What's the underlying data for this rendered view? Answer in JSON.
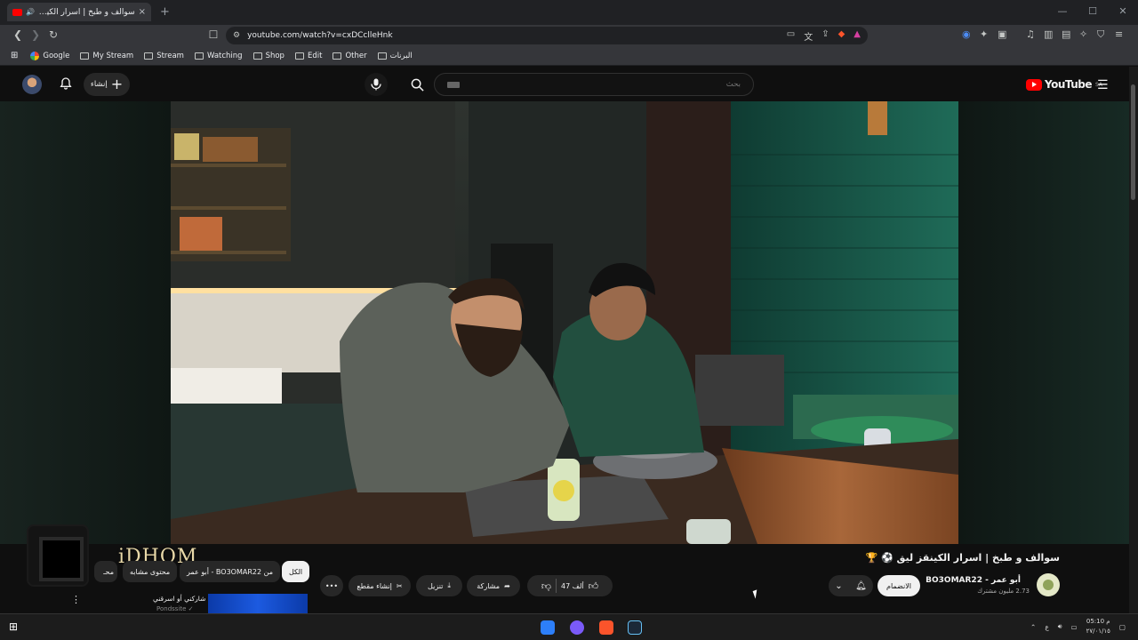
{
  "browser": {
    "tab_title": "سوالف و طبخ | اسرار الكينقز لي...",
    "tab_close": "×",
    "new_tab": "+",
    "url": "youtube.com/watch?v=cxDCclleHnk",
    "window_controls": [
      "—",
      "☐",
      "✕"
    ],
    "bookmarks": [
      {
        "label": "Google",
        "icon": "google-icon"
      },
      {
        "label": "My Stream",
        "icon": "folder-icon"
      },
      {
        "label": "Stream",
        "icon": "folder-icon"
      },
      {
        "label": "Watching",
        "icon": "folder-icon"
      },
      {
        "label": "Shop",
        "icon": "folder-icon"
      },
      {
        "label": "Edit",
        "icon": "folder-icon"
      },
      {
        "label": "Other",
        "icon": "folder-icon"
      },
      {
        "label": "البرنات",
        "icon": "folder-icon"
      }
    ]
  },
  "youtube": {
    "create_label": "إنشاء",
    "search_placeholder": "بحث",
    "logo_text": "YouTube",
    "logo_region": "SA"
  },
  "video": {
    "title": "سوالف و طبخ | اسرار الكينقز ليق ⚽ 🏆",
    "channel_name": "أبو عمر - BO3OMAR22",
    "subscribers": "2.73 مليون مشترك",
    "join_label": "الانضمام",
    "likes": "47 ألف",
    "share_label": "مشاركة",
    "download_label": "تنزيل",
    "clip_label": "إنشاء مقطع",
    "more_label": "•••"
  },
  "chips": {
    "all": "الكل",
    "from_channel": "من BO3OMAR22 - أبو عمر",
    "similar": "محتوى مشابه",
    "more": "محـ"
  },
  "overlay": {
    "watermark": "iDHOM"
  },
  "suggestion": {
    "title": "شاركني أو اسرقني",
    "channel": "Pondssite ✓"
  },
  "taskbar": {
    "time": "05:10 م",
    "date": "٢٧/٠١/١٥",
    "lang": "ع"
  }
}
